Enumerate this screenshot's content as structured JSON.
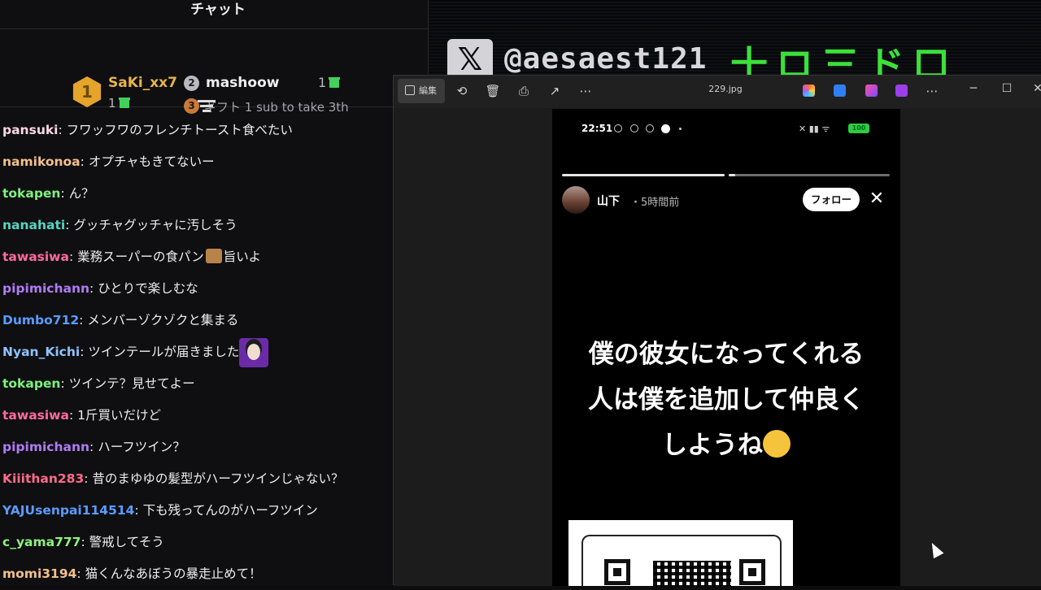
{
  "chat": {
    "title": "チャット",
    "leaderboard": {
      "first": {
        "rank": "1",
        "name": "SaKi_xx7",
        "count": "1"
      },
      "second": {
        "rank": "2",
        "name": "mashoow",
        "count": "1"
      },
      "third": {
        "rank": "3",
        "text": "ギフト 1 sub to take 3th"
      }
    },
    "messages": [
      {
        "user": "pansuki",
        "color": "#ffd7e6",
        "text": "フワッフワのフレンチトースト食べたい"
      },
      {
        "user": "namikonoa",
        "color": "#f6c08a",
        "text": "オプチャもきてないー"
      },
      {
        "user": "tokapen",
        "color": "#7cf27c",
        "text": "ん？"
      },
      {
        "user": "nanahati",
        "color": "#55d6c2",
        "text": "グッチャグッチャに汚しそう"
      },
      {
        "user": "tawasiwa",
        "color": "#ff6b9a",
        "text": "業務スーパーの食パン",
        "after": "旨いよ",
        "emote": "box"
      },
      {
        "user": "pipimichann",
        "color": "#b07cf2",
        "text": "ひとりで楽しむな"
      },
      {
        "user": "Dumbo712",
        "color": "#5b9cff",
        "text": "メンバーゾクゾクと集まる"
      },
      {
        "user": "Nyan_Kichi",
        "color": "#8fc3ff",
        "text": "ツインテールが届きました",
        "emote": "avatar"
      },
      {
        "user": "tokapen",
        "color": "#7cf27c",
        "text": "ツインテ？見せてよー"
      },
      {
        "user": "tawasiwa",
        "color": "#ff6b9a",
        "text": "1斤買いだけど"
      },
      {
        "user": "pipimichann",
        "color": "#b07cf2",
        "text": "ハーフツイン？"
      },
      {
        "user": "Kiiithan283",
        "color": "#ff6b8a",
        "text": "昔のまゆゆの髪型がハーフツインじゃない？"
      },
      {
        "user": "YAJUsenpai114514",
        "color": "#5b9cff",
        "text": "下も残ってんのがハーフツイン"
      },
      {
        "user": "c_yama777",
        "color": "#8ff27c",
        "text": "警戒してそう"
      },
      {
        "user": "momi3194",
        "color": "#f6c08a",
        "text": "猫くんなあぼうの暴走止めて！"
      }
    ]
  },
  "banner": {
    "handle": "@aesaest121",
    "deco": "十ロ三ド口"
  },
  "viewer": {
    "edit_label": "編集",
    "file_name": "229.jpg",
    "story": {
      "status_time": "22:51",
      "battery": "100",
      "user": "山下",
      "time": "・5時間前",
      "follow": "フォロー",
      "lines": [
        "僕の彼女になってくれる",
        "人は僕を追加して仲良く",
        "しようね"
      ]
    }
  }
}
